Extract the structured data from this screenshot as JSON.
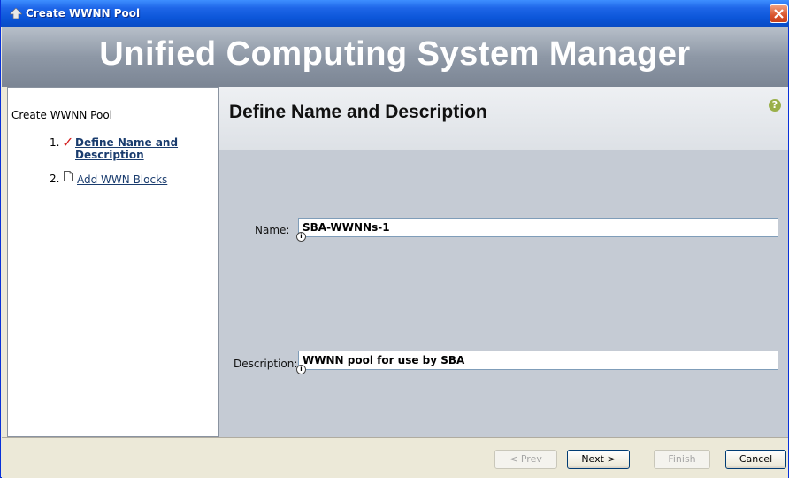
{
  "window": {
    "title": "Create WWNN Pool",
    "icons": {
      "app": "ucs-app-icon",
      "close": "close-icon"
    }
  },
  "banner": {
    "title": "Unified Computing System Manager"
  },
  "wizard": {
    "title": "Create WWNN Pool",
    "steps": [
      {
        "number": "1.",
        "label": "Define Name and Description",
        "status_icon": "checkmark-icon",
        "current": true
      },
      {
        "number": "2.",
        "label": "Add WWN Blocks",
        "status_icon": "document-icon",
        "current": false
      }
    ]
  },
  "main": {
    "heading": "Define Name and Description",
    "help_icon": "help-icon",
    "fields": {
      "name": {
        "label": "Name:",
        "value": "SBA-WWNNs-1"
      },
      "description": {
        "label": "Description:",
        "value": "WWNN pool for use by SBA"
      }
    }
  },
  "footer": {
    "buttons": {
      "prev": {
        "label": "< Prev",
        "enabled": false
      },
      "next": {
        "label": "Next >",
        "enabled": true
      },
      "finish": {
        "label": "Finish",
        "enabled": false
      },
      "cancel": {
        "label": "Cancel",
        "enabled": true
      }
    }
  },
  "colors": {
    "titlebar": "#0b55d8",
    "banner": "#8e98a6",
    "accent_link": "#1a3c6e",
    "checkmark": "#d42020"
  }
}
